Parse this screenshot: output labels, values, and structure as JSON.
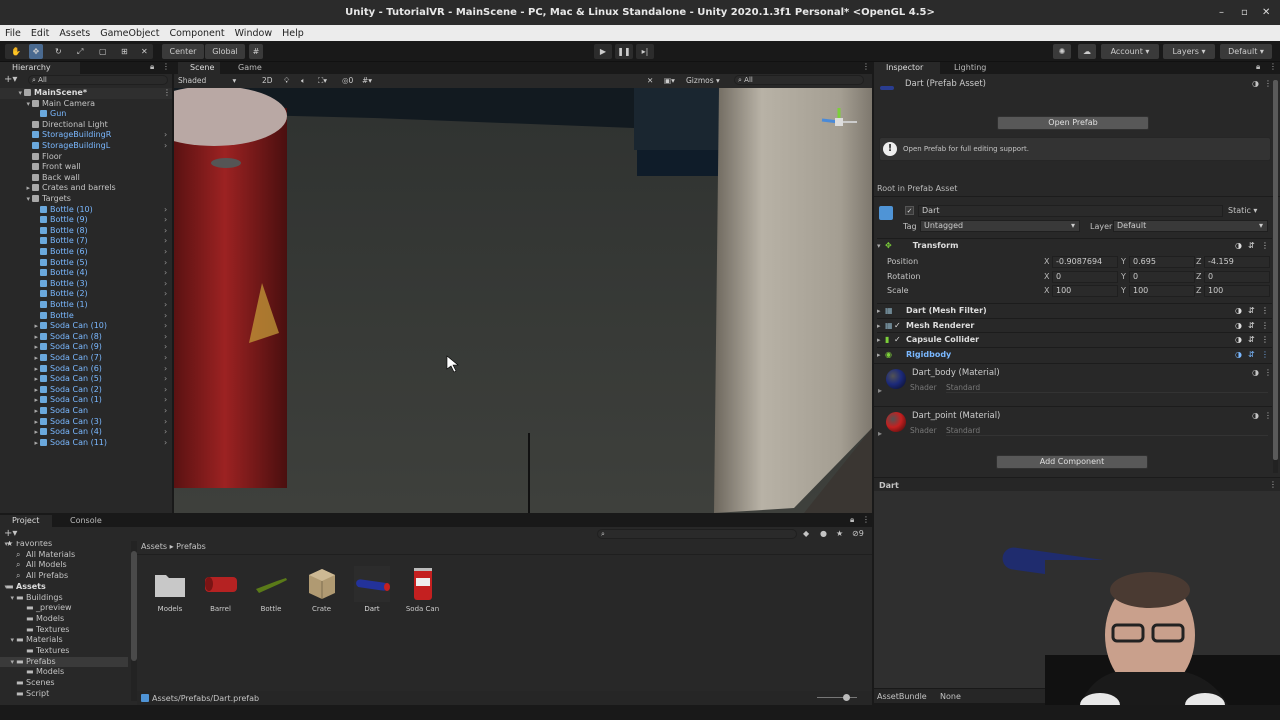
{
  "window": {
    "title": "Unity - TutorialVR - MainScene - PC, Mac & Linux Standalone - Unity 2020.1.3f1 Personal* <OpenGL 4.5>"
  },
  "menu": [
    "File",
    "Edit",
    "Assets",
    "GameObject",
    "Component",
    "Window",
    "Help"
  ],
  "toolbar": {
    "center": "Center",
    "global": "Global",
    "account": "Account",
    "layers": "Layers",
    "layout": "Default"
  },
  "hierarchy": {
    "tab": "Hierarchy",
    "search_placeholder": "All",
    "items": [
      {
        "label": "MainScene*",
        "indent": 0,
        "type": "scene",
        "expanded": true
      },
      {
        "label": "Main Camera",
        "indent": 1,
        "type": "go",
        "expanded": true
      },
      {
        "label": "Gun",
        "indent": 2,
        "type": "prefab"
      },
      {
        "label": "Directional Light",
        "indent": 1,
        "type": "go"
      },
      {
        "label": "StorageBuildingR",
        "indent": 1,
        "type": "prefab",
        "arrow": true
      },
      {
        "label": "StorageBuildingL",
        "indent": 1,
        "type": "prefab",
        "arrow": true
      },
      {
        "label": "Floor",
        "indent": 1,
        "type": "go"
      },
      {
        "label": "Front wall",
        "indent": 1,
        "type": "go"
      },
      {
        "label": "Back wall",
        "indent": 1,
        "type": "go"
      },
      {
        "label": "Crates and barrels",
        "indent": 1,
        "type": "go",
        "collapsed": true
      },
      {
        "label": "Targets",
        "indent": 1,
        "type": "go",
        "expanded": true
      },
      {
        "label": "Bottle (10)",
        "indent": 2,
        "type": "prefab",
        "arrow": true
      },
      {
        "label": "Bottle (9)",
        "indent": 2,
        "type": "prefab",
        "arrow": true
      },
      {
        "label": "Bottle (8)",
        "indent": 2,
        "type": "prefab",
        "arrow": true
      },
      {
        "label": "Bottle (7)",
        "indent": 2,
        "type": "prefab",
        "arrow": true
      },
      {
        "label": "Bottle (6)",
        "indent": 2,
        "type": "prefab",
        "arrow": true
      },
      {
        "label": "Bottle (5)",
        "indent": 2,
        "type": "prefab",
        "arrow": true
      },
      {
        "label": "Bottle (4)",
        "indent": 2,
        "type": "prefab",
        "arrow": true
      },
      {
        "label": "Bottle (3)",
        "indent": 2,
        "type": "prefab",
        "arrow": true
      },
      {
        "label": "Bottle (2)",
        "indent": 2,
        "type": "prefab",
        "arrow": true
      },
      {
        "label": "Bottle (1)",
        "indent": 2,
        "type": "prefab",
        "arrow": true
      },
      {
        "label": "Bottle",
        "indent": 2,
        "type": "prefab",
        "arrow": true
      },
      {
        "label": "Soda Can (10)",
        "indent": 2,
        "type": "prefab",
        "collapsed": true,
        "arrow": true
      },
      {
        "label": "Soda Can (8)",
        "indent": 2,
        "type": "prefab",
        "collapsed": true,
        "arrow": true
      },
      {
        "label": "Soda Can (9)",
        "indent": 2,
        "type": "prefab",
        "collapsed": true,
        "arrow": true
      },
      {
        "label": "Soda Can (7)",
        "indent": 2,
        "type": "prefab",
        "collapsed": true,
        "arrow": true
      },
      {
        "label": "Soda Can (6)",
        "indent": 2,
        "type": "prefab",
        "collapsed": true,
        "arrow": true
      },
      {
        "label": "Soda Can (5)",
        "indent": 2,
        "type": "prefab",
        "collapsed": true,
        "arrow": true
      },
      {
        "label": "Soda Can (2)",
        "indent": 2,
        "type": "prefab",
        "collapsed": true,
        "arrow": true
      },
      {
        "label": "Soda Can (1)",
        "indent": 2,
        "type": "prefab",
        "collapsed": true,
        "arrow": true
      },
      {
        "label": "Soda Can",
        "indent": 2,
        "type": "prefab",
        "collapsed": true,
        "arrow": true
      },
      {
        "label": "Soda Can (3)",
        "indent": 2,
        "type": "prefab",
        "collapsed": true,
        "arrow": true
      },
      {
        "label": "Soda Can (4)",
        "indent": 2,
        "type": "prefab",
        "collapsed": true,
        "arrow": true
      },
      {
        "label": "Soda Can (11)",
        "indent": 2,
        "type": "prefab",
        "collapsed": true,
        "arrow": true
      }
    ]
  },
  "scene": {
    "tabs": [
      "Scene",
      "Game"
    ],
    "shading": "Shaded",
    "mode2d": "2D",
    "gizmos": "Gizmos",
    "search_placeholder": "All",
    "fx_count": "0"
  },
  "inspector": {
    "tabs": [
      "Inspector",
      "Lighting"
    ],
    "asset_title": "Dart (Prefab Asset)",
    "open_prefab": "Open Prefab",
    "info": "Open Prefab for full editing support.",
    "root_label": "Root in Prefab Asset",
    "name": "Dart",
    "static_label": "Static",
    "tag_label": "Tag",
    "tag_value": "Untagged",
    "layer_label": "Layer",
    "layer_value": "Default",
    "transform": {
      "title": "Transform",
      "position_label": "Position",
      "rotation_label": "Rotation",
      "scale_label": "Scale",
      "position": {
        "x": "-0.9087694",
        "y": "0.695",
        "z": "-4.159"
      },
      "rotation": {
        "x": "0",
        "y": "0",
        "z": "0"
      },
      "scale": {
        "x": "100",
        "y": "100",
        "z": "100"
      }
    },
    "components": [
      "Dart (Mesh Filter)",
      "Mesh Renderer",
      "Capsule Collider",
      "Rigidbody"
    ],
    "materials": [
      {
        "name": "Dart_body (Material)",
        "shader_label": "Shader",
        "shader": "Standard",
        "color": "#1c2a7a"
      },
      {
        "name": "Dart_point (Material)",
        "shader_label": "Shader",
        "shader": "Standard",
        "color": "#c42020"
      }
    ],
    "add_component": "Add Component",
    "preview_label": "Dart",
    "assetbundle_label": "AssetBundle",
    "assetbundle_value": "None"
  },
  "project": {
    "tabs": [
      "Project",
      "Console"
    ],
    "tree": [
      {
        "label": "Favorites",
        "indent": 0,
        "star": true
      },
      {
        "label": "All Materials",
        "indent": 1
      },
      {
        "label": "All Models",
        "indent": 1
      },
      {
        "label": "All Prefabs",
        "indent": 1
      },
      {
        "label": "Assets",
        "indent": 0,
        "bold": true
      },
      {
        "label": "Buildings",
        "indent": 1
      },
      {
        "label": "_preview",
        "indent": 2
      },
      {
        "label": "Models",
        "indent": 2
      },
      {
        "label": "Textures",
        "indent": 2
      },
      {
        "label": "Materials",
        "indent": 1
      },
      {
        "label": "Textures",
        "indent": 2
      },
      {
        "label": "Prefabs",
        "indent": 1,
        "selected": true
      },
      {
        "label": "Models",
        "indent": 2
      },
      {
        "label": "Scenes",
        "indent": 1
      },
      {
        "label": "Script",
        "indent": 1
      }
    ],
    "breadcrumb": [
      "Assets",
      "Prefabs"
    ],
    "assets": [
      {
        "label": "Models",
        "kind": "folder"
      },
      {
        "label": "Barrel",
        "kind": "barrel"
      },
      {
        "label": "Bottle",
        "kind": "bottle"
      },
      {
        "label": "Crate",
        "kind": "crate"
      },
      {
        "label": "Dart",
        "kind": "dart",
        "selected": true
      },
      {
        "label": "Soda Can",
        "kind": "soda"
      }
    ],
    "status_path": "Assets/Prefabs/Dart.prefab",
    "hidden_count": "9"
  }
}
